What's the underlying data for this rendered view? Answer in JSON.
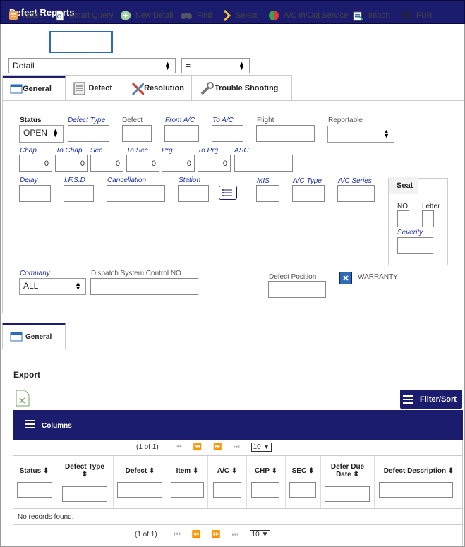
{
  "title": "Defect Reports",
  "toolbar": {
    "notes": "Notes",
    "smart_query": "Smart Query",
    "new_detail": "New Detail",
    "find": "Find",
    "select": "Select",
    "ac_inout": "A/C In/Out Service",
    "import": "Import",
    "fur": "FUR"
  },
  "filter": {
    "field": "Detail",
    "operator": "="
  },
  "tabs": [
    "General",
    "Defect",
    "Resolution",
    "Trouble Shooting"
  ],
  "form": {
    "status_label": "Status",
    "status_value": "OPEN",
    "defect_type": "Defect Type",
    "defect": "Defect",
    "from_ac": "From A/C",
    "to_ac": "To A/C",
    "flight": "Flight",
    "reportable": "Reportable",
    "chap": "Chap",
    "to_chap": "To Chap",
    "sec": "Sec",
    "to_sec": "To Sec",
    "prg": "Prg",
    "to_prg": "To Prg",
    "asc": "ASC",
    "zero": "0",
    "delay": "Delay",
    "ifsd": "I.F.S.D",
    "cancellation": "Cancellation",
    "station": "Station",
    "mis": "MIS",
    "ac_type": "A/C Type",
    "ac_series": "A/C Series",
    "seat": "Seat",
    "no": "NO",
    "letter": "Letter",
    "severity": "Severity",
    "company": "Company",
    "company_value": "ALL",
    "dispatch": "Dispatch System Control NO",
    "defect_position": "Defect Position",
    "warranty": "WARRANTY"
  },
  "lower_tab": "General",
  "export": "Export",
  "filter_sort": "Filter/Sort",
  "columns_label": "Columns",
  "pager": {
    "pages": "(1 of 1)",
    "per_page": "10"
  },
  "table": {
    "headers": [
      "Status",
      "Defect Type",
      "Defect",
      "Item",
      "A/C",
      "CHP",
      "SEC",
      "Defer Due Date",
      "Defect Description"
    ],
    "empty": "No records found."
  }
}
